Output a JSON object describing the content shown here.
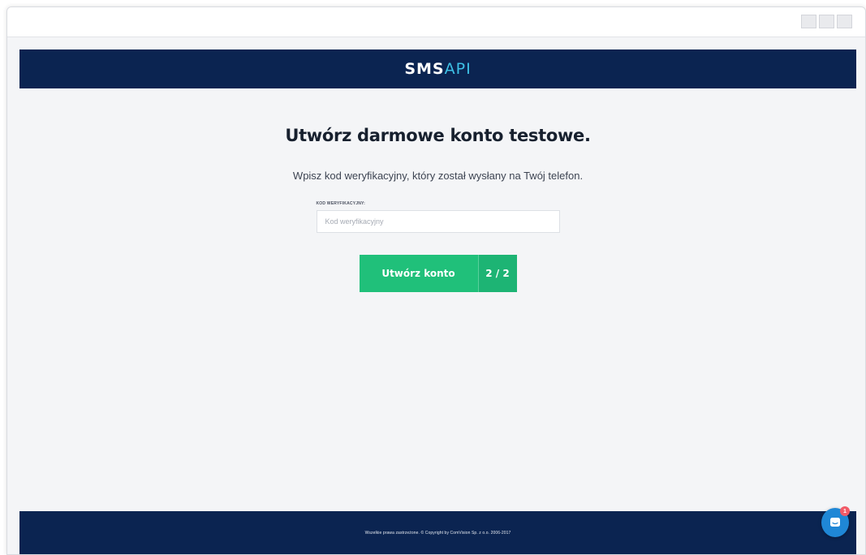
{
  "header": {
    "logo_main": "SMS",
    "logo_accent": "API"
  },
  "main": {
    "title": "Utwórz darmowe konto testowe.",
    "subtitle": "Wpisz kod weryfikacyjny, który został wysłany na Twój telefon.",
    "verification_field": {
      "label": "Kod weryfikacyjny:",
      "placeholder": "Kod weryfikacyjny",
      "value": ""
    },
    "submit": {
      "label": "Utwórz konto",
      "step": "2 / 2"
    }
  },
  "footer": {
    "copyright": "Wszelkie prawa zastrzeżone. © Copyright by ComVision Sp. z o.o. 2006-2017"
  },
  "chat": {
    "icon": "chat-bubble-icon",
    "badge_count": "1"
  },
  "colors": {
    "brand_navy": "#0b2451",
    "accent_cyan": "#3ec1e6",
    "button_green": "#20c07a",
    "chat_blue": "#1f87d6",
    "badge_red": "#f25a67"
  }
}
